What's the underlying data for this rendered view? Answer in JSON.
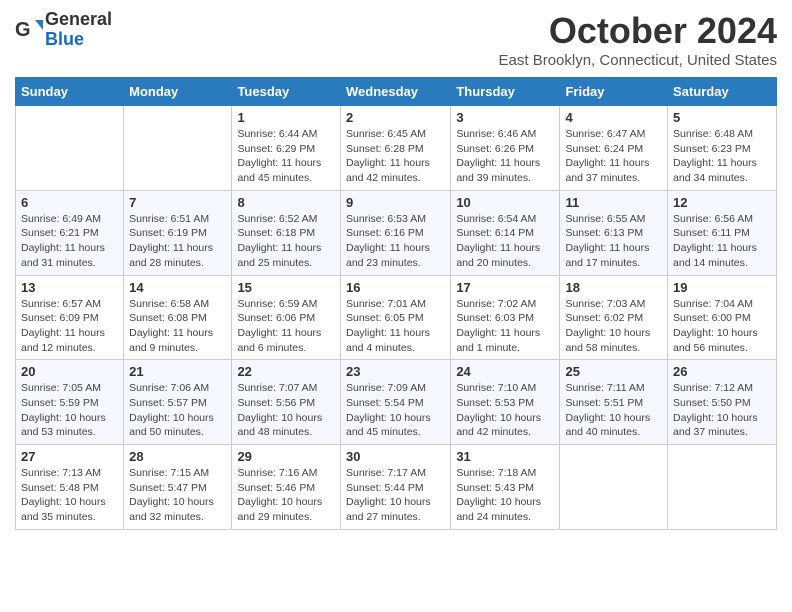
{
  "header": {
    "logo_general": "General",
    "logo_blue": "Blue",
    "month_title": "October 2024",
    "location": "East Brooklyn, Connecticut, United States"
  },
  "days_of_week": [
    "Sunday",
    "Monday",
    "Tuesday",
    "Wednesday",
    "Thursday",
    "Friday",
    "Saturday"
  ],
  "weeks": [
    [
      {
        "day": "",
        "info": ""
      },
      {
        "day": "",
        "info": ""
      },
      {
        "day": "1",
        "info": "Sunrise: 6:44 AM\nSunset: 6:29 PM\nDaylight: 11 hours and 45 minutes."
      },
      {
        "day": "2",
        "info": "Sunrise: 6:45 AM\nSunset: 6:28 PM\nDaylight: 11 hours and 42 minutes."
      },
      {
        "day": "3",
        "info": "Sunrise: 6:46 AM\nSunset: 6:26 PM\nDaylight: 11 hours and 39 minutes."
      },
      {
        "day": "4",
        "info": "Sunrise: 6:47 AM\nSunset: 6:24 PM\nDaylight: 11 hours and 37 minutes."
      },
      {
        "day": "5",
        "info": "Sunrise: 6:48 AM\nSunset: 6:23 PM\nDaylight: 11 hours and 34 minutes."
      }
    ],
    [
      {
        "day": "6",
        "info": "Sunrise: 6:49 AM\nSunset: 6:21 PM\nDaylight: 11 hours and 31 minutes."
      },
      {
        "day": "7",
        "info": "Sunrise: 6:51 AM\nSunset: 6:19 PM\nDaylight: 11 hours and 28 minutes."
      },
      {
        "day": "8",
        "info": "Sunrise: 6:52 AM\nSunset: 6:18 PM\nDaylight: 11 hours and 25 minutes."
      },
      {
        "day": "9",
        "info": "Sunrise: 6:53 AM\nSunset: 6:16 PM\nDaylight: 11 hours and 23 minutes."
      },
      {
        "day": "10",
        "info": "Sunrise: 6:54 AM\nSunset: 6:14 PM\nDaylight: 11 hours and 20 minutes."
      },
      {
        "day": "11",
        "info": "Sunrise: 6:55 AM\nSunset: 6:13 PM\nDaylight: 11 hours and 17 minutes."
      },
      {
        "day": "12",
        "info": "Sunrise: 6:56 AM\nSunset: 6:11 PM\nDaylight: 11 hours and 14 minutes."
      }
    ],
    [
      {
        "day": "13",
        "info": "Sunrise: 6:57 AM\nSunset: 6:09 PM\nDaylight: 11 hours and 12 minutes."
      },
      {
        "day": "14",
        "info": "Sunrise: 6:58 AM\nSunset: 6:08 PM\nDaylight: 11 hours and 9 minutes."
      },
      {
        "day": "15",
        "info": "Sunrise: 6:59 AM\nSunset: 6:06 PM\nDaylight: 11 hours and 6 minutes."
      },
      {
        "day": "16",
        "info": "Sunrise: 7:01 AM\nSunset: 6:05 PM\nDaylight: 11 hours and 4 minutes."
      },
      {
        "day": "17",
        "info": "Sunrise: 7:02 AM\nSunset: 6:03 PM\nDaylight: 11 hours and 1 minute."
      },
      {
        "day": "18",
        "info": "Sunrise: 7:03 AM\nSunset: 6:02 PM\nDaylight: 10 hours and 58 minutes."
      },
      {
        "day": "19",
        "info": "Sunrise: 7:04 AM\nSunset: 6:00 PM\nDaylight: 10 hours and 56 minutes."
      }
    ],
    [
      {
        "day": "20",
        "info": "Sunrise: 7:05 AM\nSunset: 5:59 PM\nDaylight: 10 hours and 53 minutes."
      },
      {
        "day": "21",
        "info": "Sunrise: 7:06 AM\nSunset: 5:57 PM\nDaylight: 10 hours and 50 minutes."
      },
      {
        "day": "22",
        "info": "Sunrise: 7:07 AM\nSunset: 5:56 PM\nDaylight: 10 hours and 48 minutes."
      },
      {
        "day": "23",
        "info": "Sunrise: 7:09 AM\nSunset: 5:54 PM\nDaylight: 10 hours and 45 minutes."
      },
      {
        "day": "24",
        "info": "Sunrise: 7:10 AM\nSunset: 5:53 PM\nDaylight: 10 hours and 42 minutes."
      },
      {
        "day": "25",
        "info": "Sunrise: 7:11 AM\nSunset: 5:51 PM\nDaylight: 10 hours and 40 minutes."
      },
      {
        "day": "26",
        "info": "Sunrise: 7:12 AM\nSunset: 5:50 PM\nDaylight: 10 hours and 37 minutes."
      }
    ],
    [
      {
        "day": "27",
        "info": "Sunrise: 7:13 AM\nSunset: 5:48 PM\nDaylight: 10 hours and 35 minutes."
      },
      {
        "day": "28",
        "info": "Sunrise: 7:15 AM\nSunset: 5:47 PM\nDaylight: 10 hours and 32 minutes."
      },
      {
        "day": "29",
        "info": "Sunrise: 7:16 AM\nSunset: 5:46 PM\nDaylight: 10 hours and 29 minutes."
      },
      {
        "day": "30",
        "info": "Sunrise: 7:17 AM\nSunset: 5:44 PM\nDaylight: 10 hours and 27 minutes."
      },
      {
        "day": "31",
        "info": "Sunrise: 7:18 AM\nSunset: 5:43 PM\nDaylight: 10 hours and 24 minutes."
      },
      {
        "day": "",
        "info": ""
      },
      {
        "day": "",
        "info": ""
      }
    ]
  ]
}
